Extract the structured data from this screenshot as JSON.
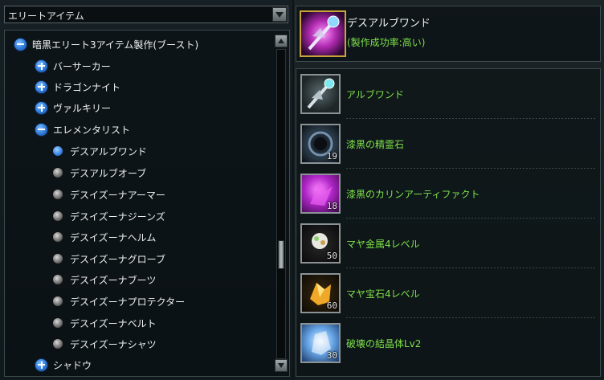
{
  "dropdown": {
    "label": "エリートアイテム"
  },
  "tree": {
    "root": {
      "label": "暗黒エリート3アイテム製作(ブースト)",
      "state": "expanded"
    },
    "categories": [
      {
        "label": "バーサーカー",
        "state": "collapsed"
      },
      {
        "label": "ドラゴンナイト",
        "state": "collapsed"
      },
      {
        "label": "ヴァルキリー",
        "state": "collapsed"
      },
      {
        "label": "エレメンタリスト",
        "state": "expanded"
      }
    ],
    "items": [
      {
        "label": "デスアルブワンド",
        "selected": true
      },
      {
        "label": "デスアルブオーブ",
        "selected": false
      },
      {
        "label": "デスイズーナアーマー",
        "selected": false
      },
      {
        "label": "デスイズーナジーンズ",
        "selected": false
      },
      {
        "label": "デスイズーナヘルム",
        "selected": false
      },
      {
        "label": "デスイズーナグローブ",
        "selected": false
      },
      {
        "label": "デスイズーナブーツ",
        "selected": false
      },
      {
        "label": "デスイズーナプロテクター",
        "selected": false
      },
      {
        "label": "デスイズーナベルト",
        "selected": false
      },
      {
        "label": "デスイズーナシャツ",
        "selected": false
      }
    ],
    "last_category": {
      "label": "シャドウ",
      "state": "collapsed"
    }
  },
  "result": {
    "name": "デスアルブワンド",
    "rate": "(製作成功率:高い)",
    "icon": "wand-icon"
  },
  "materials": [
    {
      "name": "アルブワンド",
      "qty": "",
      "icon": "wand-icon"
    },
    {
      "name": "漆黒の精霊石",
      "qty": "19",
      "icon": "spirit-stone-icon"
    },
    {
      "name": "漆黒のカリンアーティファクト",
      "qty": "18",
      "icon": "artifact-icon"
    },
    {
      "name": "マヤ金属4レベル",
      "qty": "50",
      "icon": "metal-icon"
    },
    {
      "name": "マヤ宝石4レベル",
      "qty": "60",
      "icon": "gem-icon"
    },
    {
      "name": "破壊の結晶体Lv2",
      "qty": "30",
      "icon": "crystal-icon"
    }
  ],
  "colors": {
    "accent_green": "#7ee04a",
    "frame_gold": "#c9a43a",
    "toggle_blue": "#2f79d8"
  }
}
